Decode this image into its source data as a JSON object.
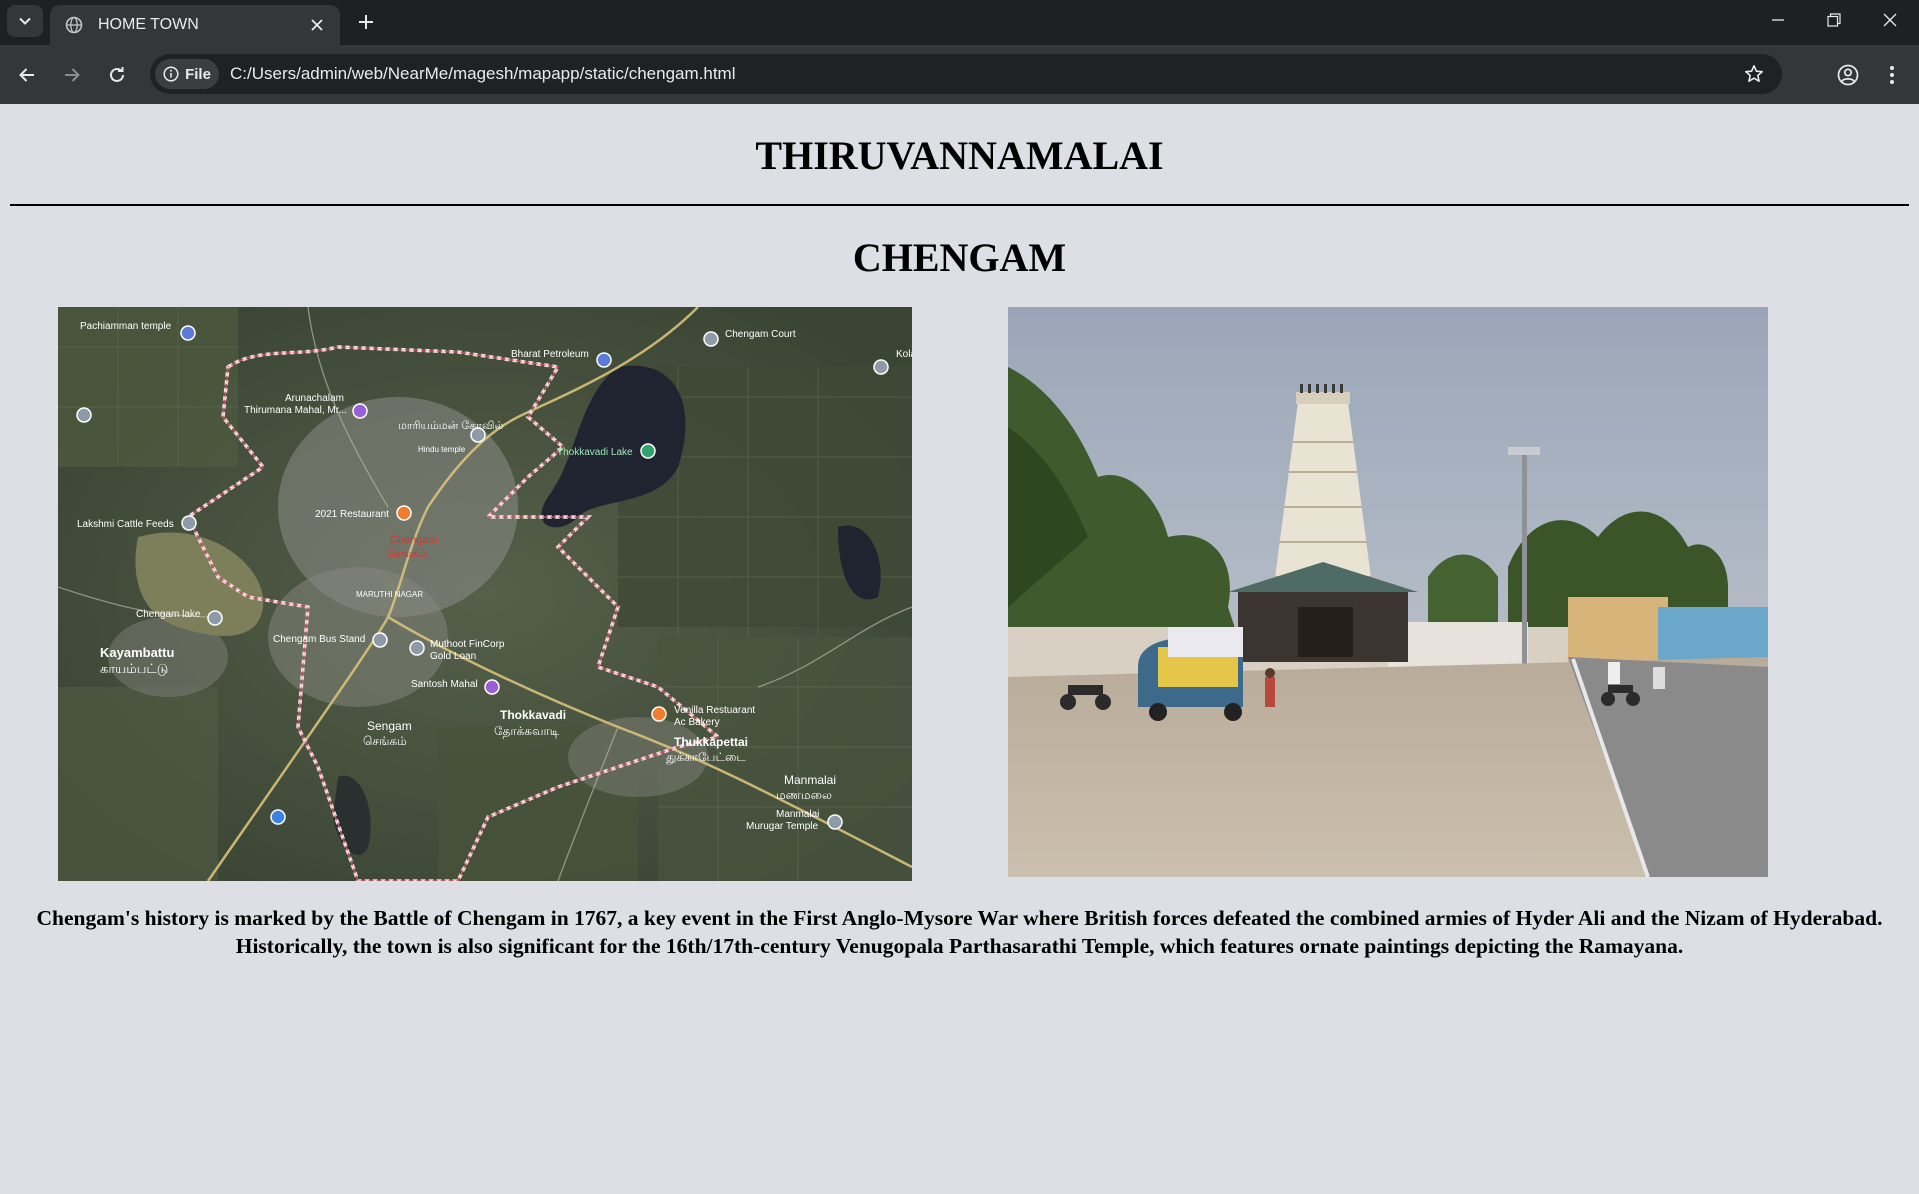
{
  "browser": {
    "tab_title": "HOME TOWN",
    "url_chip": "File",
    "url": "C:/Users/admin/web/NearMe/magesh/mapapp/static/chengam.html"
  },
  "page": {
    "district_heading": "THIRUVANNAMALAI",
    "town_heading": "CHENGAM",
    "description": "Chengam's history is marked by the Battle of Chengam in 1767, a key event in the First Anglo-Mysore War where British forces defeated the combined armies of Hyder Ali and the Nizam of Hyderabad. Historically, the town is also significant for the 16th/17th-century Venugopala Parthasarathi Temple, which features ornate paintings depicting the Ramayana."
  },
  "map": {
    "labels": {
      "pachiamman": "Pachiamman temple",
      "bharat": "Bharat Petroleum",
      "court": "Chengam Court",
      "arunachalam_1": "Arunachalam",
      "arunachalam_2": "Thirumana Mahal, Mr...",
      "mariamman": "மாரியம்மன் கோவில்",
      "hindu_temple": "Hindu temple",
      "lake": "Thokkavadi Lake",
      "restaurant": "2021 Restaurant",
      "chengam": "Chengam",
      "chengam_ta": "செங்கம்",
      "lakshmi": "Lakshmi Cattle Feeds",
      "maruthi": "MARUTHI NAGAR",
      "chengam_lake": "Chengam lake",
      "bus_stand": "Chengam Bus Stand",
      "muthoot_1": "Muthoot FinCorp",
      "muthoot_2": "Gold Loan",
      "kayambattu": "Kayambattu",
      "kayambattu_ta": "காயம்பட்டு",
      "santosh": "Santosh Mahal",
      "thokkavadi": "Thokkavadi",
      "thokkavadi_ta": "தோக்கவாடி",
      "venilla_1": "Venilla Restuarant",
      "venilla_2": "Ac Bakery",
      "sengam": "Sengam",
      "sengam_ta": "செங்கம்",
      "thukkapettai": "Thukkapettai",
      "thukkapettai_ta": "துக்காபேட்டை",
      "manmalai": "Manmalai",
      "manmalai_ta": "மணமலை",
      "murugar_1": "Manmalai",
      "murugar_2": "Murugar Temple",
      "kola": "Kola"
    }
  }
}
